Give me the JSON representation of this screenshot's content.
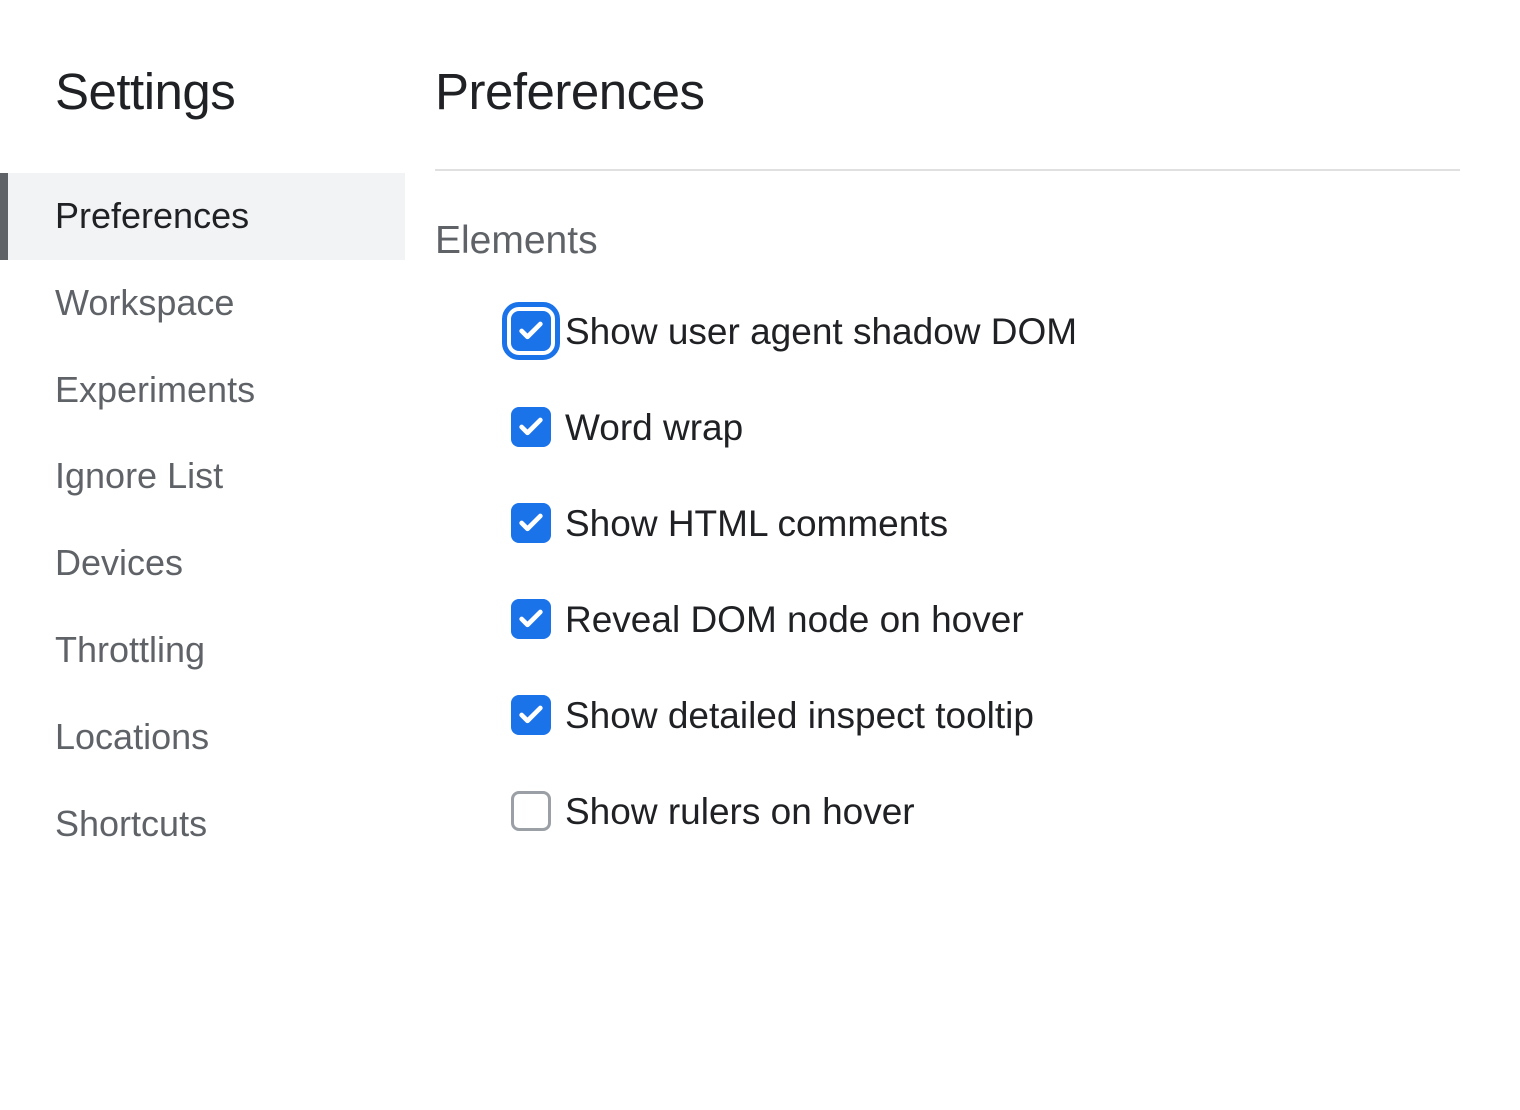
{
  "sidebar": {
    "title": "Settings",
    "items": [
      {
        "label": "Preferences",
        "active": true
      },
      {
        "label": "Workspace",
        "active": false
      },
      {
        "label": "Experiments",
        "active": false
      },
      {
        "label": "Ignore List",
        "active": false
      },
      {
        "label": "Devices",
        "active": false
      },
      {
        "label": "Throttling",
        "active": false
      },
      {
        "label": "Locations",
        "active": false
      },
      {
        "label": "Shortcuts",
        "active": false
      }
    ]
  },
  "main": {
    "title": "Preferences",
    "section": "Elements",
    "options": [
      {
        "label": "Show user agent shadow DOM",
        "checked": true,
        "focused": true
      },
      {
        "label": "Word wrap",
        "checked": true,
        "focused": false
      },
      {
        "label": "Show HTML comments",
        "checked": true,
        "focused": false
      },
      {
        "label": "Reveal DOM node on hover",
        "checked": true,
        "focused": false
      },
      {
        "label": "Show detailed inspect tooltip",
        "checked": true,
        "focused": false
      },
      {
        "label": "Show rulers on hover",
        "checked": false,
        "focused": false
      }
    ]
  }
}
